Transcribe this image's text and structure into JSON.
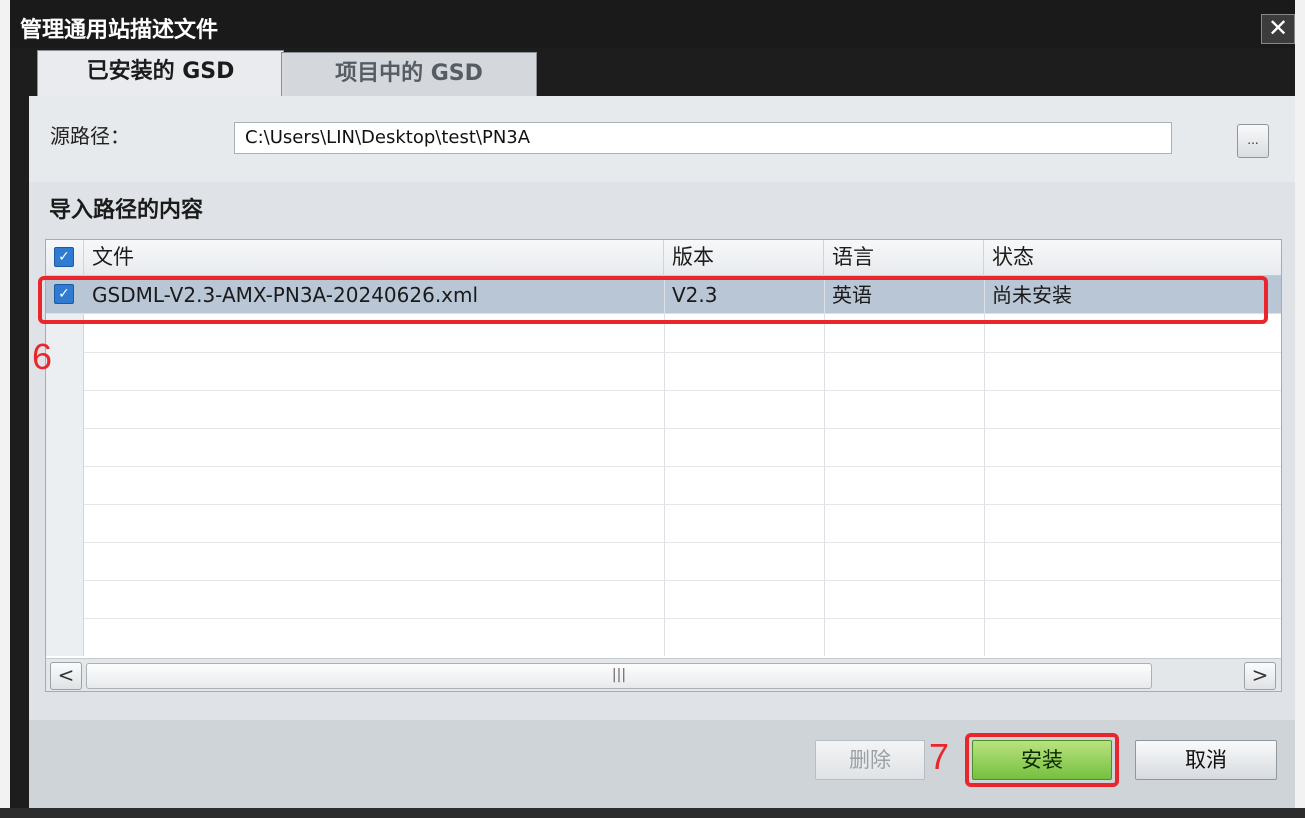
{
  "window": {
    "title": "管理通用站描述文件",
    "close_glyph": "✕"
  },
  "tabs": [
    {
      "label": "已安装的 GSD",
      "active": true
    },
    {
      "label": "项目中的 GSD",
      "active": false
    }
  ],
  "source": {
    "label": "源路径：",
    "value": "C:\\Users\\LIN\\Desktop\\test\\PN3A",
    "browse_label": "..."
  },
  "section_title": "导入路径的内容",
  "table": {
    "columns": [
      "文件",
      "版本",
      "语言",
      "状态"
    ],
    "rows": [
      {
        "checked": true,
        "file": "GSDML-V2.3-AMX-PN3A-20240626.xml",
        "version": "V2.3",
        "language": "英语",
        "status": "尚未安装"
      }
    ]
  },
  "scrollbar": {
    "left_arrow": "<",
    "right_arrow": ">",
    "thumb_grip": "|||"
  },
  "annotations": {
    "row_marker": "6",
    "button_marker": "7",
    "color": "#e8262b"
  },
  "buttons": {
    "delete": "删除",
    "install": "安装",
    "cancel": "取消"
  }
}
